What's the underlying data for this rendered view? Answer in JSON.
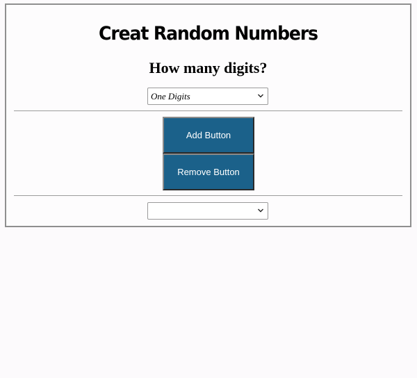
{
  "header": {
    "title": "Creat Random Numbers",
    "subtitle": "How many digits?"
  },
  "digits_select": {
    "selected": "One Digits"
  },
  "buttons": {
    "add_label": "Add Button",
    "remove_label": "Remove Button",
    "color": "#1b618a"
  },
  "result_select": {
    "selected": ""
  }
}
